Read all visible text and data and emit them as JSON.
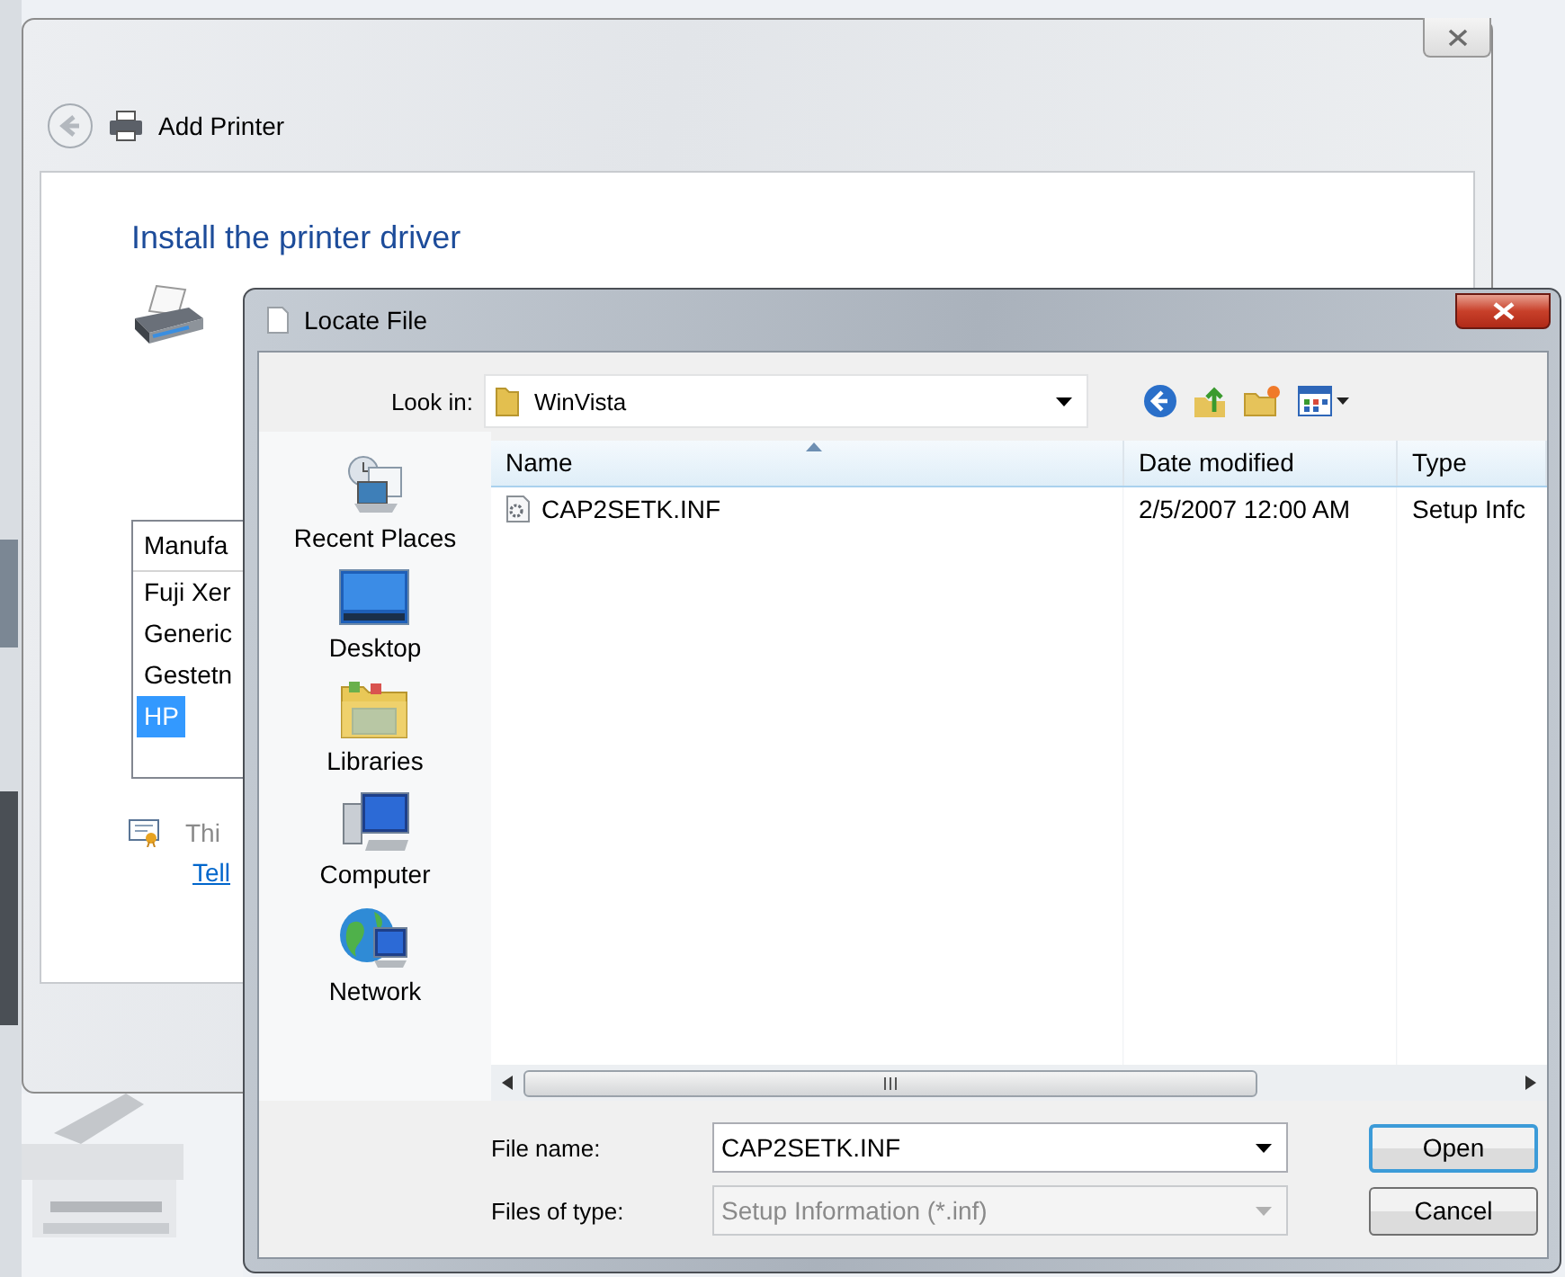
{
  "add_printer": {
    "title": "Add Printer",
    "heading": "Install the printer driver",
    "manufacturer_list": {
      "header": "Manufa",
      "items": [
        {
          "label": "Fuji Xer",
          "selected": false
        },
        {
          "label": "Generic",
          "selected": false
        },
        {
          "label": "Gestetn",
          "selected": false
        },
        {
          "label": "HP",
          "selected": true
        }
      ]
    },
    "note": "Thi",
    "link": "Tell"
  },
  "locate_file": {
    "title": "Locate File",
    "look_in_label": "Look in:",
    "look_in_value": "WinVista",
    "places": [
      {
        "label": "Recent Places",
        "kind": "recent"
      },
      {
        "label": "Desktop",
        "kind": "desktop"
      },
      {
        "label": "Libraries",
        "kind": "libraries"
      },
      {
        "label": "Computer",
        "kind": "computer"
      },
      {
        "label": "Network",
        "kind": "network"
      }
    ],
    "columns": [
      "Name",
      "Date modified",
      "Type"
    ],
    "files": [
      {
        "name": "CAP2SETK.INF",
        "date_modified": "2/5/2007 12:00 AM",
        "type": "Setup Infc"
      }
    ],
    "file_name_label": "File name:",
    "file_name": "CAP2SETK.INF",
    "file_type_label": "Files of type:",
    "file_type": {
      "value": "Setup Information (*.inf)",
      "disabled": true
    },
    "buttons": [
      {
        "label": "Open",
        "default": true
      },
      {
        "label": "Cancel",
        "default": false
      }
    ]
  }
}
